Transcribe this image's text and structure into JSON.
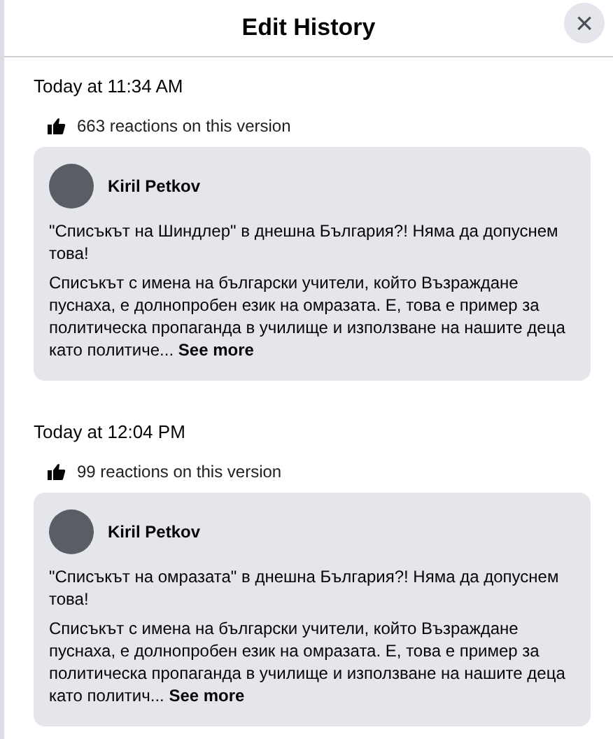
{
  "dialog": {
    "title": "Edit History",
    "close_label": "×"
  },
  "versions": [
    {
      "time": "Today at 11:34 AM",
      "reactions": "663 reactions on this version",
      "author": "Kiril Petkov",
      "headline": "\"Списъкът на Шиндлер\" в днешна България?! Няма да допуснем това!",
      "body": "Списъкът с имена на български учители, който Възраждане пуснаха, е долнопробен език на омразата. Е, това е пример за политическа пропаганда в училище и използване на нашите деца като политиче...",
      "see_more": "See more"
    },
    {
      "time": "Today at 12:04 PM",
      "reactions": "99 reactions on this version",
      "author": "Kiril Petkov",
      "headline": "\"Списъкът на омразата\" в днешна България?! Няма да допуснем това!",
      "body": "Списъкът с имена на български учители, който Възраждане пуснаха, е долнопробен език на омразата. Е, това е пример за политическа пропаганда в училище и използване на нашите деца като политич...",
      "see_more": "See more"
    }
  ]
}
